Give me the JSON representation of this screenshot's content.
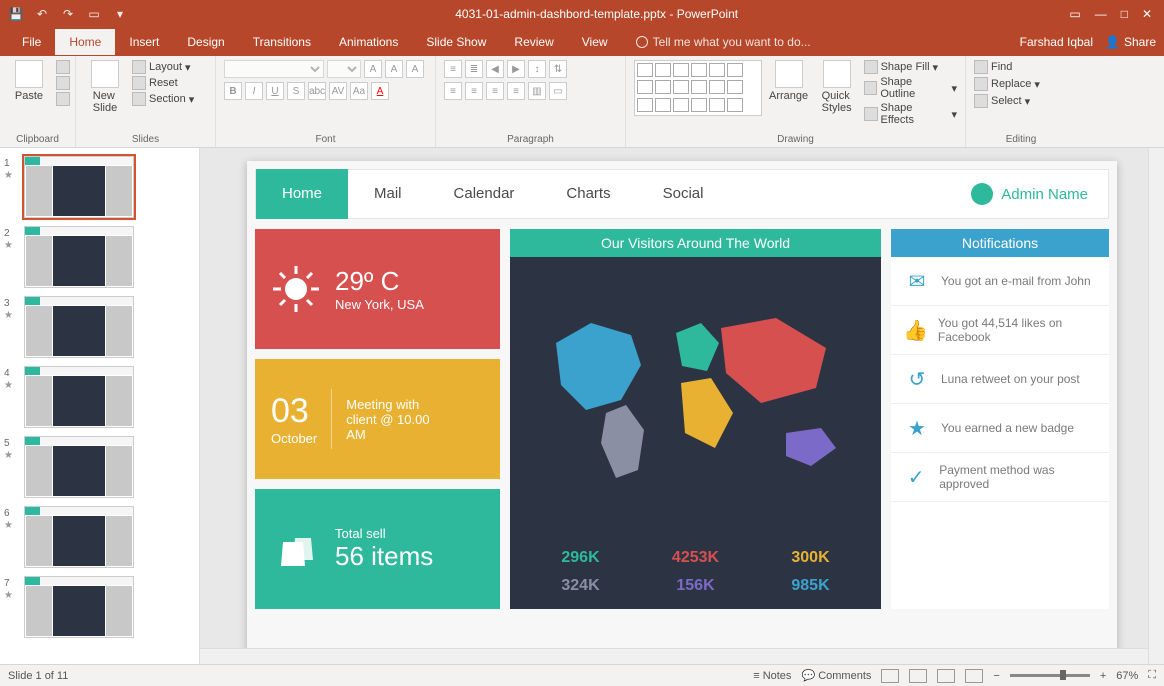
{
  "window_title": "4031-01-admin-dashbord-template.pptx - PowerPoint",
  "user_name": "Farshad Iqbal",
  "share_label": "Share",
  "menu": {
    "file": "File",
    "tabs": [
      "Home",
      "Insert",
      "Design",
      "Transitions",
      "Animations",
      "Slide Show",
      "Review",
      "View"
    ],
    "tell": "Tell me what you want to do..."
  },
  "ribbon": {
    "clipboard": {
      "label": "Clipboard",
      "paste": "Paste"
    },
    "slides": {
      "label": "Slides",
      "new": "New\nSlide",
      "layout": "Layout",
      "reset": "Reset",
      "section": "Section"
    },
    "font": {
      "label": "Font"
    },
    "paragraph": {
      "label": "Paragraph"
    },
    "drawing": {
      "label": "Drawing",
      "arrange": "Arrange",
      "quick": "Quick\nStyles",
      "fill": "Shape Fill",
      "outline": "Shape Outline",
      "effects": "Shape Effects"
    },
    "editing": {
      "label": "Editing",
      "find": "Find",
      "replace": "Replace",
      "select": "Select"
    }
  },
  "thumbs": [
    "1",
    "2",
    "3",
    "4",
    "5",
    "6",
    "7"
  ],
  "slide": {
    "nav": [
      "Home",
      "Mail",
      "Calendar",
      "Charts",
      "Social"
    ],
    "admin": "Admin Name",
    "weather": {
      "temp": "29º C",
      "loc": "New York, USA"
    },
    "meeting": {
      "day": "03",
      "month": "October",
      "text": "Meeting with client @ 10.00 AM"
    },
    "sell": {
      "label": "Total sell",
      "value": "56 items"
    },
    "visitors_hd": "Our Visitors Around The World",
    "stats": [
      {
        "v": "296K",
        "c": "#2eb89c"
      },
      {
        "v": "4253K",
        "c": "#d65050"
      },
      {
        "v": "300K",
        "c": "#e8b131"
      },
      {
        "v": "324K",
        "c": "#8a8fa3"
      },
      {
        "v": "156K",
        "c": "#7c6ac8"
      },
      {
        "v": "985K",
        "c": "#3ba2cd"
      }
    ],
    "notif_hd": "Notifications",
    "notifs": [
      {
        "t": "You got an e-mail from John",
        "i": "✉"
      },
      {
        "t": "You got 44,514 likes on Facebook",
        "i": "👍"
      },
      {
        "t": "Luna retweet on your post",
        "i": "↺"
      },
      {
        "t": "You earned a new badge",
        "i": "★"
      },
      {
        "t": "Payment method was approved",
        "i": "✓"
      }
    ]
  },
  "status": {
    "slide": "Slide 1 of 11",
    "notes": "Notes",
    "comments": "Comments",
    "zoom": "67%"
  }
}
